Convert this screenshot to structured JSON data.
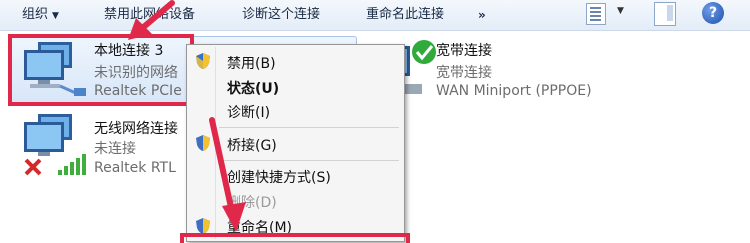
{
  "toolbar": {
    "organize": "组织",
    "disable_device": "禁用此网络设备",
    "diagnose": "诊断这个连接",
    "rename": "重命名此连接",
    "more": "»"
  },
  "connections": [
    {
      "name": "本地连接 3",
      "status": "未识别的网络",
      "device": "Realtek PCIe"
    },
    {
      "name": "无线网络连接",
      "status": "未连接",
      "device": "Realtek RTL"
    },
    {
      "name": "宽带连接",
      "status": "宽带连接",
      "device": "WAN Miniport (PPPOE)"
    }
  ],
  "context_menu": [
    {
      "label": "禁用(B)",
      "icon": "shield-icon"
    },
    {
      "label": "状态(U)",
      "bold": true
    },
    {
      "label": "诊断(I)"
    },
    {
      "label": "桥接(G)",
      "icon": "shield-icon"
    },
    {
      "label": "创建快捷方式(S)"
    },
    {
      "label": "删除(D)",
      "disabled": true
    },
    {
      "label": "重命名(M)",
      "icon": "shield-icon"
    }
  ],
  "colors": {
    "annotation": "#e0294a",
    "toolbar_text": "#1a2b45"
  }
}
